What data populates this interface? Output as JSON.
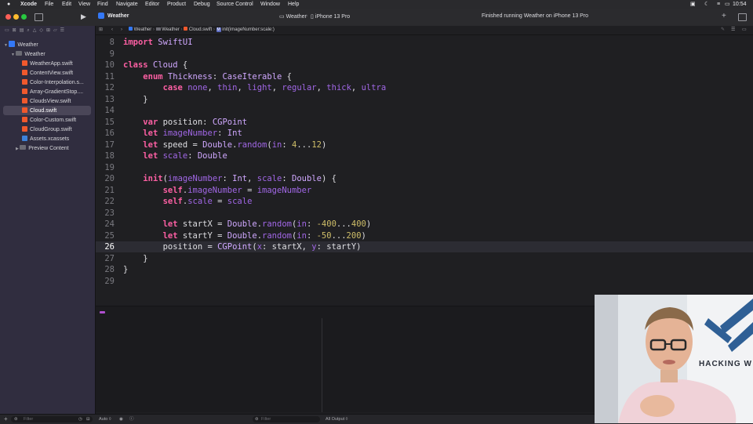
{
  "menubar": {
    "items": [
      "Xcode",
      "File",
      "Edit",
      "View",
      "Find",
      "Navigate",
      "Editor",
      "Product",
      "Debug",
      "Source Control",
      "Window",
      "Help"
    ],
    "clock": "10:54"
  },
  "toolbar": {
    "project_title": "Weather",
    "scheme": "Weather",
    "destination": "iPhone 13 Pro",
    "status": "Finished running Weather on iPhone 13 Pro"
  },
  "sidebar": {
    "project": "Weather",
    "group": "Weather",
    "files": [
      "WeatherApp.swift",
      "ContentView.swift",
      "Color-Interpolation.s...",
      "Array-GradientStop....",
      "CloudsView.swift",
      "Cloud.swift",
      "Color-Custom.swift",
      "CloudGroup.swift"
    ],
    "assets": "Assets.xcassets",
    "preview": "Preview Content",
    "filter_placeholder": "Filter"
  },
  "jumpbar": {
    "crumbs": [
      "Weather",
      "Weather",
      "Cloud.swift",
      "init(imageNumber:scale:)"
    ]
  },
  "editor": {
    "line_numbers": [
      "8",
      "9",
      "10",
      "11",
      "12",
      "13",
      "14",
      "15",
      "16",
      "17",
      "18",
      "19",
      "20",
      "21",
      "22",
      "23",
      "24",
      "25",
      "26",
      "27",
      "28",
      "29"
    ],
    "current_line": "26",
    "code": [
      "import SwiftUI",
      "",
      "class Cloud {",
      "    enum Thickness: CaseIterable {",
      "        case none, thin, light, regular, thick, ultra",
      "    }",
      "",
      "    var position: CGPoint",
      "    let imageNumber: Int",
      "    let speed = Double.random(in: 4...12)",
      "    let scale: Double",
      "",
      "    init(imageNumber: Int, scale: Double) {",
      "        self.imageNumber = imageNumber",
      "        self.scale = scale",
      "",
      "        let startX = Double.random(in: -400...400)",
      "        let startY = Double.random(in: -50...200)",
      "        position = CGPoint(x: startX, y: startY)",
      "    }",
      "}",
      ""
    ]
  },
  "debug": {
    "auto_label": "Auto ◊",
    "filter_placeholder": "Filter",
    "output_label": "All Output ◊"
  },
  "pip": {
    "banner_text": "HACKING W"
  }
}
